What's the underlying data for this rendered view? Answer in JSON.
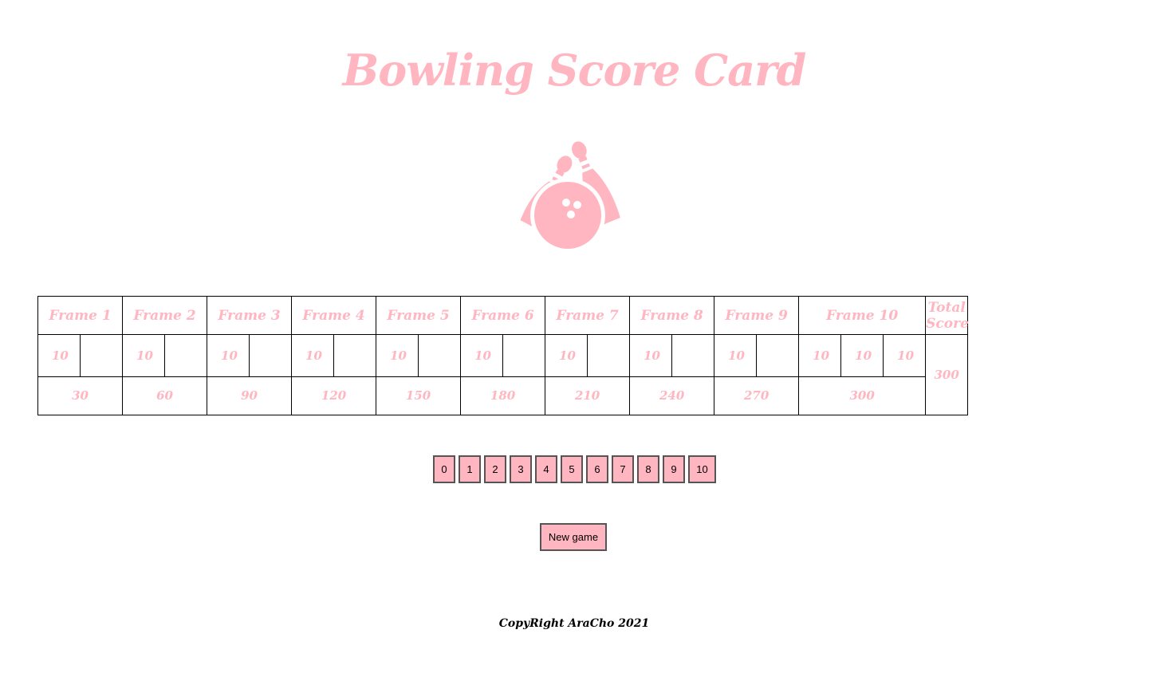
{
  "title": "Bowling Score Card",
  "logo_icon": "bowling-ball-pins-icon",
  "accent_color": "#ffb6c1",
  "scorecard": {
    "headers": [
      "Frame 1",
      "Frame 2",
      "Frame 3",
      "Frame 4",
      "Frame 5",
      "Frame 6",
      "Frame 7",
      "Frame 8",
      "Frame 9",
      "Frame 10",
      "Total Score"
    ],
    "frames": [
      {
        "rolls": [
          "10",
          ""
        ],
        "cumulative": "30"
      },
      {
        "rolls": [
          "10",
          ""
        ],
        "cumulative": "60"
      },
      {
        "rolls": [
          "10",
          ""
        ],
        "cumulative": "90"
      },
      {
        "rolls": [
          "10",
          ""
        ],
        "cumulative": "120"
      },
      {
        "rolls": [
          "10",
          ""
        ],
        "cumulative": "150"
      },
      {
        "rolls": [
          "10",
          ""
        ],
        "cumulative": "180"
      },
      {
        "rolls": [
          "10",
          ""
        ],
        "cumulative": "210"
      },
      {
        "rolls": [
          "10",
          ""
        ],
        "cumulative": "240"
      },
      {
        "rolls": [
          "10",
          ""
        ],
        "cumulative": "270"
      },
      {
        "rolls": [
          "10",
          "10",
          "10"
        ],
        "cumulative": "300"
      }
    ],
    "total": "300"
  },
  "pin_buttons": [
    "0",
    "1",
    "2",
    "3",
    "4",
    "5",
    "6",
    "7",
    "8",
    "9",
    "10"
  ],
  "new_game_label": "New game",
  "footer": "CopyRight AraCho 2021"
}
